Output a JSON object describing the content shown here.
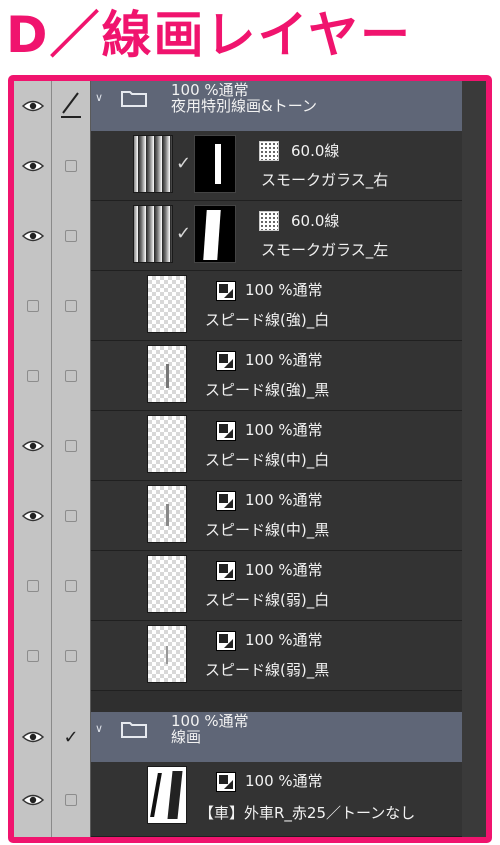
{
  "title": "D／線画レイヤー",
  "colors": {
    "accent": "#f0146e",
    "folder_row": "#5f6677",
    "layer_row": "#333333"
  },
  "group1": {
    "opacity_mode": "100 %通常",
    "name": "夜用特別線画&トーン"
  },
  "layers_a": [
    {
      "mode": "60.0線",
      "name": "スモークガラス_右"
    },
    {
      "mode": "60.0線",
      "name": "スモークガラス_左"
    }
  ],
  "layers_b": [
    {
      "mode": "100 %通常",
      "name": "スピード線(強)_白"
    },
    {
      "mode": "100 %通常",
      "name": "スピード線(強)_黒"
    },
    {
      "mode": "100 %通常",
      "name": "スピード線(中)_白"
    },
    {
      "mode": "100 %通常",
      "name": "スピード線(中)_黒"
    },
    {
      "mode": "100 %通常",
      "name": "スピード線(弱)_白"
    },
    {
      "mode": "100 %通常",
      "name": "スピード線(弱)_黒"
    }
  ],
  "group2": {
    "opacity_mode": "100 %通常",
    "name": "線画"
  },
  "layer_last": {
    "mode": "100 %通常",
    "name": "【車】外車R_赤25／トーンなし"
  }
}
